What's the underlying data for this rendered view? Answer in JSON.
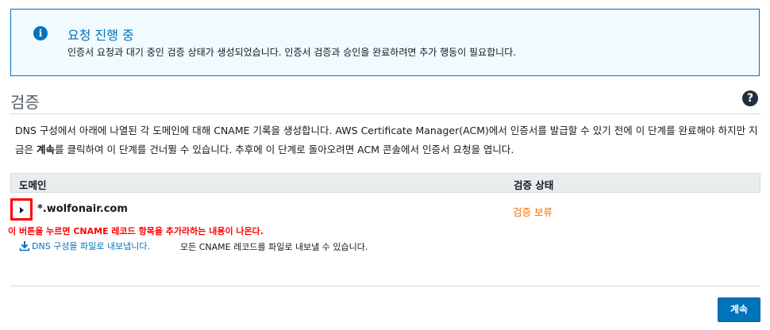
{
  "info": {
    "icon": "info-icon",
    "title": "요청 진행 중",
    "text": "인증서 요청과 대기 중인 검증 상태가 생성되었습니다. 인증서 검증과 승인을 완료하려면 추가 행동이 필요합니다."
  },
  "section": {
    "title": "검증",
    "help_icon": "help-icon"
  },
  "description": {
    "part1": "DNS 구성에서 아래에 나열된 각 도메인에 대해 CNAME 기록을 생성합니다. AWS Certificate Manager(ACM)에서 인증서를 발급할 수 있기 전에 이 단계를 완료해야 하지만 지금은 ",
    "bold": "계속",
    "part2": "를 클릭하여 이 단계를 건너뛸 수 있습니다. 추후에 이 단계로 돌아오려면 ACM 콘솔에서 인증서 요청을 엽니다."
  },
  "table": {
    "headers": {
      "domain": "도메인",
      "status": "검증 상태"
    },
    "rows": [
      {
        "domain": "*.wolfonair.com",
        "status": "검증 보류"
      }
    ]
  },
  "annotation": "이 버튼을 누르면 CNAME 레코드 항목을 추가라하는 내용이 나온다.",
  "export": {
    "link": "DNS 구성을 파일로 내보냅니다.",
    "description": "모든 CNAME 레코드를 파일로 내보낼 수 있습니다."
  },
  "footer": {
    "continue_label": "계속"
  },
  "colors": {
    "accent": "#0073bb",
    "status_pending": "#ec7211",
    "annotation": "#ff0000"
  }
}
